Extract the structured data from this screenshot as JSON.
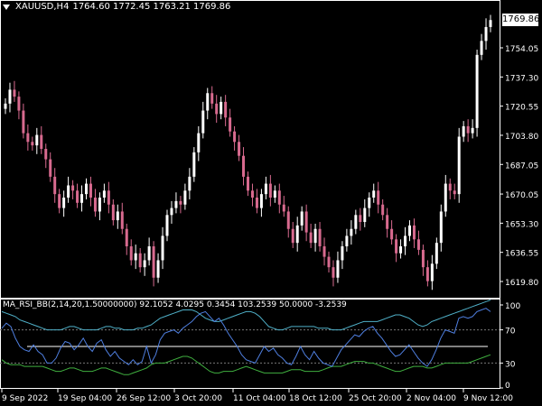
{
  "header": {
    "symbol": "XAUUSD,H4",
    "ohlc": "1764.60 1772.45 1763.21 1769.86"
  },
  "current_price": "1769.86",
  "price_axis": [
    "1754.05",
    "1737.30",
    "1720.55",
    "1703.80",
    "1687.05",
    "1670.05",
    "1653.30",
    "1636.55",
    "1619.80"
  ],
  "indicator": {
    "label": "MA_RSI_BB(2,14,20,1.50000000) 92.1052 4.0295 0.3454 103.2539 50.0000 -3.2539",
    "axis": [
      "100",
      "70",
      "30",
      "0"
    ]
  },
  "time_axis": [
    "9 Sep 2022",
    "19 Sep 04:00",
    "26 Sep 12:00",
    "3 Oct 20:00",
    "11 Oct 04:00",
    "18 Oct 12:00",
    "25 Oct 20:00",
    "2 Nov 04:00",
    "9 Nov 12:00"
  ],
  "colors": {
    "bull": "#ffffff",
    "bear": "#d86a8f",
    "rsi": "#4f7fe0",
    "upper_band": "#4fb0c8",
    "lower_band": "#3fae3f",
    "mid_line": "#ffffff",
    "grid": "#777777"
  },
  "chart_data": {
    "type": "candlestick",
    "price_closes": [
      1722,
      1730,
      1726,
      1718,
      1705,
      1700,
      1698,
      1704,
      1696,
      1690,
      1680,
      1670,
      1662,
      1668,
      1675,
      1672,
      1665,
      1670,
      1676,
      1668,
      1660,
      1668,
      1672,
      1664,
      1655,
      1660,
      1650,
      1640,
      1632,
      1636,
      1628,
      1632,
      1640,
      1622,
      1632,
      1646,
      1658,
      1662,
      1666,
      1664,
      1672,
      1680,
      1694,
      1705,
      1718,
      1728,
      1722,
      1716,
      1723,
      1714,
      1706,
      1700,
      1692,
      1680,
      1672,
      1668,
      1662,
      1670,
      1676,
      1668,
      1672,
      1664,
      1660,
      1650,
      1642,
      1652,
      1660,
      1648,
      1642,
      1650,
      1640,
      1634,
      1628,
      1622,
      1632,
      1640,
      1646,
      1650,
      1658,
      1654,
      1662,
      1668,
      1672,
      1664,
      1658,
      1650,
      1644,
      1636,
      1640,
      1646,
      1652,
      1644,
      1638,
      1628,
      1620,
      1630,
      1642,
      1660,
      1676,
      1672,
      1670,
      1703,
      1709,
      1705,
      1708,
      1750,
      1758,
      1766,
      1770
    ],
    "rsi": [
      72,
      78,
      74,
      60,
      50,
      46,
      44,
      52,
      44,
      40,
      30,
      30,
      36,
      48,
      56,
      54,
      46,
      52,
      60,
      50,
      44,
      54,
      58,
      46,
      38,
      44,
      36,
      32,
      28,
      34,
      28,
      32,
      50,
      30,
      40,
      58,
      66,
      68,
      70,
      66,
      72,
      76,
      80,
      86,
      90,
      92,
      86,
      80,
      84,
      76,
      66,
      58,
      50,
      40,
      34,
      32,
      30,
      40,
      50,
      44,
      48,
      40,
      36,
      30,
      28,
      38,
      50,
      40,
      34,
      44,
      36,
      30,
      28,
      26,
      36,
      46,
      52,
      58,
      64,
      62,
      68,
      72,
      74,
      66,
      60,
      52,
      44,
      38,
      40,
      46,
      52,
      44,
      36,
      30,
      26,
      34,
      46,
      60,
      70,
      68,
      66,
      84,
      86,
      84,
      86,
      92,
      94,
      96,
      92
    ],
    "upper_band": [
      92,
      90,
      88,
      86,
      82,
      80,
      78,
      76,
      74,
      72,
      70,
      70,
      70,
      70,
      72,
      74,
      74,
      72,
      70,
      70,
      70,
      70,
      72,
      74,
      74,
      72,
      72,
      70,
      70,
      70,
      72,
      72,
      74,
      76,
      80,
      84,
      86,
      88,
      90,
      92,
      94,
      94,
      94,
      92,
      88,
      84,
      82,
      80,
      80,
      82,
      84,
      86,
      88,
      90,
      92,
      92,
      90,
      86,
      80,
      74,
      72,
      70,
      70,
      72,
      74,
      74,
      74,
      74,
      74,
      74,
      72,
      72,
      72,
      70,
      70,
      70,
      72,
      74,
      76,
      78,
      80,
      80,
      80,
      80,
      82,
      84,
      86,
      88,
      88,
      86,
      84,
      80,
      76,
      74,
      76,
      80,
      82,
      84,
      86,
      88,
      90,
      92,
      94,
      96,
      98,
      100,
      102,
      104,
      106
    ],
    "lower_band": [
      34,
      30,
      28,
      28,
      28,
      26,
      26,
      26,
      26,
      26,
      24,
      22,
      20,
      20,
      22,
      24,
      24,
      22,
      20,
      20,
      20,
      22,
      24,
      24,
      22,
      20,
      18,
      16,
      16,
      18,
      20,
      22,
      24,
      28,
      30,
      30,
      30,
      32,
      34,
      36,
      38,
      38,
      36,
      32,
      28,
      24,
      20,
      18,
      18,
      20,
      20,
      20,
      22,
      24,
      26,
      24,
      22,
      20,
      18,
      18,
      18,
      18,
      18,
      20,
      22,
      22,
      22,
      20,
      20,
      20,
      20,
      22,
      24,
      26,
      26,
      26,
      28,
      30,
      32,
      32,
      32,
      30,
      30,
      28,
      26,
      24,
      22,
      20,
      20,
      22,
      24,
      26,
      26,
      26,
      24,
      24,
      26,
      28,
      30,
      30,
      30,
      30,
      30,
      30,
      32,
      34,
      36,
      38,
      40
    ]
  }
}
